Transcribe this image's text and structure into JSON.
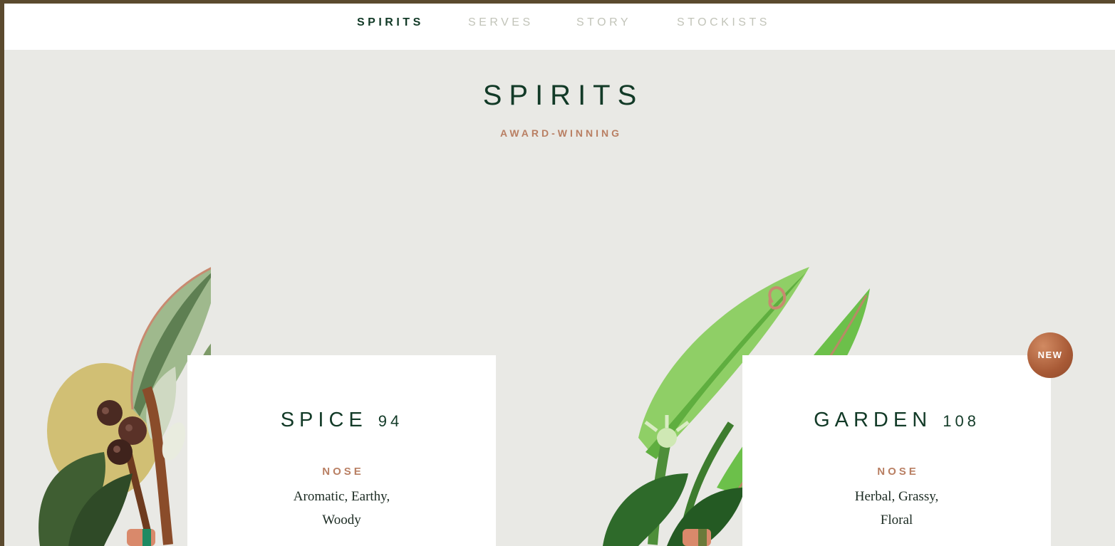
{
  "nav": {
    "items": [
      {
        "label": "SPIRITS"
      },
      {
        "label": "SERVES"
      },
      {
        "label": "STORY"
      },
      {
        "label": "STOCKISTS"
      }
    ]
  },
  "page": {
    "title": "SPIRITS",
    "subtitle": "AWARD-WINNING"
  },
  "products": [
    {
      "name": "SPICE",
      "number": "94",
      "label": "NOSE",
      "desc_line1": "Aromatic, Earthy,",
      "desc_line2": "Woody"
    },
    {
      "name": "GARDEN",
      "number": "108",
      "label": "NOSE",
      "desc_line1": "Herbal, Grassy,",
      "desc_line2": "Floral",
      "badge": "NEW"
    }
  ],
  "colors": {
    "brand_green": "#123a27",
    "copper": "#b97f63",
    "nav_inactive": "#c2c4b9",
    "background": "#e9e9e5"
  }
}
